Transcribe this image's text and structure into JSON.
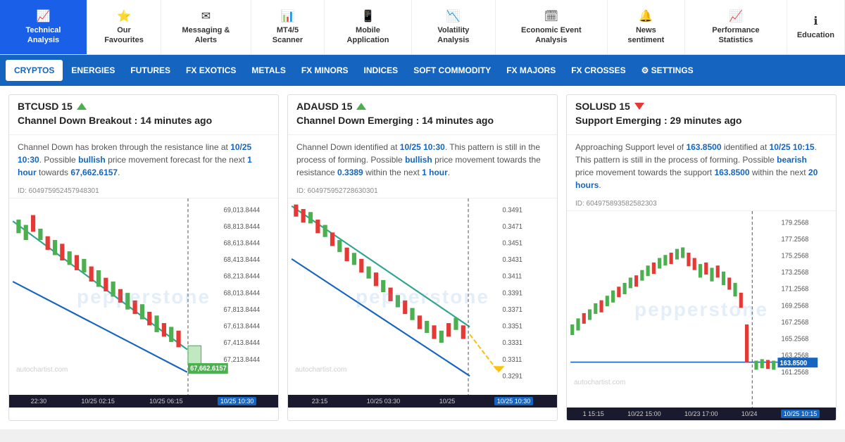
{
  "nav": {
    "items": [
      {
        "id": "technical-analysis",
        "icon": "📈",
        "label": "Technical\nAnalysis",
        "active": true
      },
      {
        "id": "our-favourites",
        "icon": "⭐",
        "label": "Our\nFavourites",
        "active": false
      },
      {
        "id": "messaging-alerts",
        "icon": "✉",
        "label": "Messaging &\nAlerts",
        "active": false
      },
      {
        "id": "mt45-scanner",
        "icon": "📊",
        "label": "MT4/5\nScanner",
        "active": false
      },
      {
        "id": "mobile-application",
        "icon": "📱",
        "label": "Mobile\nApplication",
        "active": false
      },
      {
        "id": "volatility-analysis",
        "icon": "📉",
        "label": "Volatility\nAnalysis",
        "active": false
      },
      {
        "id": "economic-event-analysis",
        "icon": "🗓",
        "label": "Economic Event\nAnalysis",
        "active": false
      },
      {
        "id": "news-sentiment",
        "icon": "🔔",
        "label": "News\nsentiment",
        "active": false
      },
      {
        "id": "performance-statistics",
        "icon": "📈",
        "label": "Performance\nStatistics",
        "active": false
      },
      {
        "id": "education",
        "icon": "ℹ",
        "label": "Education",
        "active": false
      }
    ]
  },
  "categories": {
    "items": [
      {
        "id": "cryptos",
        "label": "CRYPTOS",
        "active": true
      },
      {
        "id": "energies",
        "label": "ENERGIES",
        "active": false
      },
      {
        "id": "futures",
        "label": "FUTURES",
        "active": false
      },
      {
        "id": "fx-exotics",
        "label": "FX EXOTICS",
        "active": false
      },
      {
        "id": "metals",
        "label": "METALS",
        "active": false
      },
      {
        "id": "fx-minors",
        "label": "FX MINORS",
        "active": false
      },
      {
        "id": "indices",
        "label": "INDICES",
        "active": false
      },
      {
        "id": "soft-commodity",
        "label": "SOFT COMMODITY",
        "active": false
      },
      {
        "id": "fx-majors",
        "label": "FX MAJORS",
        "active": false
      },
      {
        "id": "fx-crosses",
        "label": "FX CROSSES",
        "active": false
      },
      {
        "id": "settings",
        "label": "⚙ SETTINGS",
        "active": false
      }
    ]
  },
  "cards": [
    {
      "id": "btcusd",
      "symbol": "BTCUSD 15",
      "direction": "up",
      "pattern": "Channel Down Breakout : 14 minutes ago",
      "description": "Channel Down has broken through the resistance line at 10/25 10:30. Possible bullish price movement forecast for the next 1 hour towards 67,662.6157.",
      "card_id": "ID: 604975952457948301",
      "price_level": "67,662.6157",
      "times": [
        "22:30",
        "10/25 02:15",
        "10/25 06:15",
        "10/25 10:30"
      ],
      "prices": [
        "69,013.8444",
        "68,813.8444",
        "68,613.8444",
        "68,413.8444",
        "68,213.8444",
        "68,013.8444",
        "67,813.8444",
        "67,613.8444",
        "67,413.8444",
        "67,213.8444"
      ]
    },
    {
      "id": "adausd",
      "symbol": "ADAUSD 15",
      "direction": "up",
      "pattern": "Channel Down Emerging : 14 minutes ago",
      "description": "Channel Down identified at 10/25 10:30. This pattern is still in the process of forming. Possible bullish price movement towards the resistance 0.3389 within the next 1 hour.",
      "card_id": "ID: 604975952728630301",
      "price_level": "0.3389",
      "times": [
        "23:15",
        "10/25 03:30",
        "10/25",
        "10/25 10:30"
      ],
      "prices": [
        "0.3491",
        "0.3471",
        "0.3451",
        "0.3431",
        "0.3411",
        "0.3391",
        "0.3371",
        "0.3351",
        "0.3331",
        "0.3311",
        "0.3291"
      ]
    },
    {
      "id": "solusd",
      "symbol": "SOLUSD 15",
      "direction": "down",
      "pattern": "Support Emerging : 29 minutes ago",
      "description": "Approaching Support level of 163.8500 identified at 10/25 10:15. This pattern is still in the process of forming. Possible bearish price movement towards the support 163.8500 within the next 20 hours.",
      "card_id": "ID: 604975893582582303",
      "price_level": "163.8500",
      "times": [
        "1 15:15",
        "10/22 15:00",
        "10/23 17:00",
        "10/24",
        "10/25 10:15"
      ],
      "prices": [
        "179.2568",
        "177.2568",
        "175.2568",
        "173.2568",
        "171.2568",
        "169.2568",
        "167.2568",
        "165.2568",
        "163.2568",
        "161.2568"
      ]
    }
  ],
  "watermark": "pepperstone",
  "autochartist": "autochartist.com"
}
